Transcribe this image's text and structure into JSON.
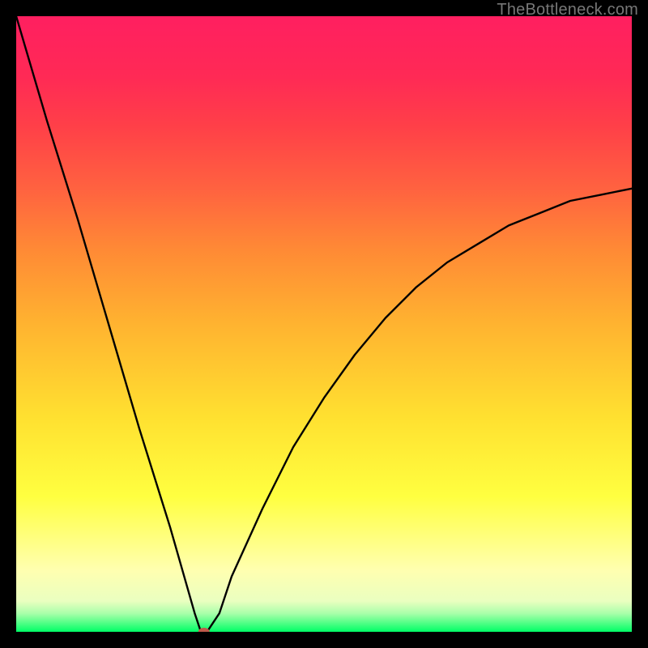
{
  "watermark": "TheBottleneck.com",
  "chart_data": {
    "type": "line",
    "title": "",
    "xlabel": "",
    "ylabel": "",
    "xlim": [
      0,
      100
    ],
    "ylim": [
      0,
      100
    ],
    "grid": false,
    "legend": false,
    "series": [
      {
        "name": "curve",
        "x": [
          0,
          5,
          10,
          15,
          20,
          25,
          29,
          30,
          31,
          33,
          35,
          40,
          45,
          50,
          55,
          60,
          65,
          70,
          75,
          80,
          85,
          90,
          95,
          100
        ],
        "values": [
          100,
          83,
          67,
          50,
          33,
          17,
          3,
          0,
          0,
          3,
          9,
          20,
          30,
          38,
          45,
          51,
          56,
          60,
          63,
          66,
          68,
          70,
          71,
          72
        ]
      }
    ],
    "marker": {
      "x": 30.5,
      "y": 0,
      "color": "#c05a4a"
    },
    "gradient_stops": [
      {
        "pos": 0,
        "color": "#00ff66"
      },
      {
        "pos": 3,
        "color": "#aaffaa"
      },
      {
        "pos": 5,
        "color": "#eaffc0"
      },
      {
        "pos": 10,
        "color": "#ffffb0"
      },
      {
        "pos": 22,
        "color": "#ffff40"
      },
      {
        "pos": 35,
        "color": "#ffe030"
      },
      {
        "pos": 50,
        "color": "#ffb330"
      },
      {
        "pos": 62,
        "color": "#ff8a35"
      },
      {
        "pos": 72,
        "color": "#ff6240"
      },
      {
        "pos": 82,
        "color": "#ff4048"
      },
      {
        "pos": 90,
        "color": "#ff2a55"
      },
      {
        "pos": 100,
        "color": "#ff1f60"
      }
    ]
  }
}
